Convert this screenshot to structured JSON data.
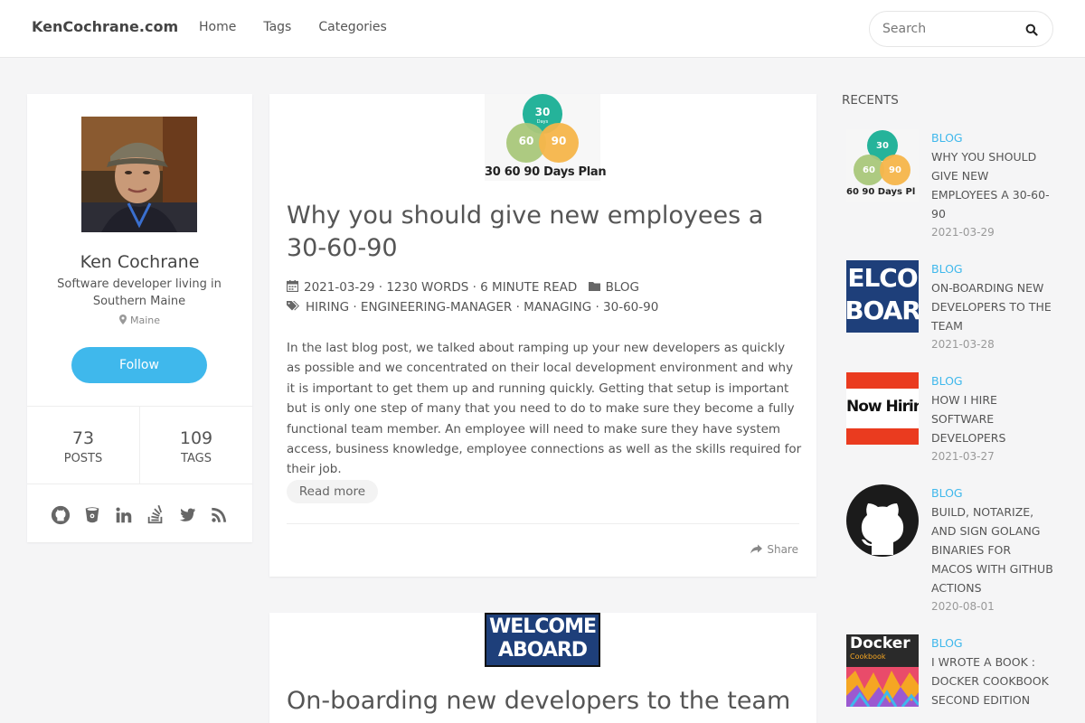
{
  "header": {
    "brand": "KenCochrane.com",
    "nav": [
      "Home",
      "Tags",
      "Categories"
    ],
    "search_placeholder": "Search"
  },
  "profile": {
    "name": "Ken Cochrane",
    "description": "Software developer living in Southern Maine",
    "location": "Maine",
    "follow_label": "Follow",
    "posts_count": "73",
    "posts_label": "POSTS",
    "tags_count": "109",
    "tags_label": "TAGS",
    "social_icons": [
      "github-icon",
      "bitbucket-icon",
      "linkedin-icon",
      "stackoverflow-icon",
      "twitter-icon",
      "rss-icon"
    ]
  },
  "posts": [
    {
      "thumb_circles": [
        "30",
        "60",
        "90"
      ],
      "thumb_sub": "Days",
      "thumb_caption": "30 60 90 Days Plan",
      "title": "Why you should give new employees a 30-60-90",
      "meta_line": "2021-03-29 · 1230 WORDS · 6 MINUTE READ",
      "category": "BLOG",
      "tags": "HIRING · ENGINEERING-MANAGER · MANAGING · 30-60-90",
      "excerpt": "In the last blog post, we talked about ramping up your new developers as quickly as possible and we concentrated on their local development environment and why it is important to get them up and running quickly. Getting that setup is important but is only one step of many that you need to do to make sure they become a fully functional team member. An employee will need to make sure they have system access, business knowledge, employee connections as well as the skills required for their job.",
      "read_more": "Read more",
      "share": "Share"
    },
    {
      "thumb_line1": "WELCOME",
      "thumb_line2": "ABOARD",
      "title": "On-boarding new developers to the team"
    }
  ],
  "recents": {
    "title": "RECENTS",
    "items": [
      {
        "category": "BLOG",
        "title": "WHY YOU SHOULD GIVE NEW EMPLOYEES A 30-60-90",
        "date": "2021-03-29",
        "thumb_text": "60 90 Days Pl"
      },
      {
        "category": "BLOG",
        "title": "ON-BOARDING NEW DEVELOPERS TO THE TEAM",
        "date": "2021-03-28",
        "thumb_line1": "ELCO",
        "thumb_line2": "BOAR"
      },
      {
        "category": "BLOG",
        "title": "HOW I HIRE SOFTWARE DEVELOPERS",
        "date": "2021-03-27",
        "thumb_text": "Now Hiring"
      },
      {
        "category": "BLOG",
        "title": "BUILD, NOTARIZE, AND SIGN GOLANG BINARIES FOR MACOS WITH GITHUB ACTIONS",
        "date": "2020-08-01"
      },
      {
        "category": "BLOG",
        "title": "I WROTE A BOOK : DOCKER COOKBOOK SECOND EDITION",
        "date": "",
        "thumb_text": "Docker",
        "thumb_sub": "Cookbook"
      }
    ]
  },
  "colors": {
    "accent": "#3fb8ec",
    "background": "#f5f5f6"
  }
}
